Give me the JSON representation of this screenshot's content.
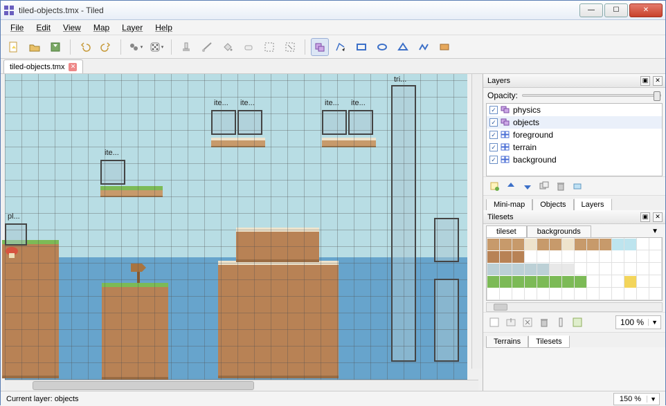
{
  "window": {
    "title": "tiled-objects.tmx - Tiled"
  },
  "menubar": [
    "File",
    "Edit",
    "View",
    "Map",
    "Layer",
    "Help"
  ],
  "doc_tab": {
    "label": "tiled-objects.tmx"
  },
  "layers_panel": {
    "title": "Layers",
    "opacity_label": "Opacity:",
    "layers": [
      {
        "name": "physics",
        "type": "object",
        "checked": true
      },
      {
        "name": "objects",
        "type": "object",
        "checked": true,
        "selected": true
      },
      {
        "name": "foreground",
        "type": "tile",
        "checked": true
      },
      {
        "name": "terrain",
        "type": "tile",
        "checked": true
      },
      {
        "name": "background",
        "type": "tile",
        "checked": true
      }
    ],
    "tabs": [
      "Mini-map",
      "Objects",
      "Layers"
    ],
    "active_tab": "Layers"
  },
  "tilesets_panel": {
    "title": "Tilesets",
    "tabs": [
      "tileset",
      "backgrounds"
    ],
    "active_tab": "tileset",
    "zoom": "100 %",
    "bottom_tabs": [
      "Terrains",
      "Tilesets"
    ],
    "active_bottom_tab": "Tilesets"
  },
  "canvas": {
    "object_labels": {
      "pl": "pl...",
      "ite1": "ite...",
      "ite2": "ite...",
      "ite3": "ite...",
      "ite4": "ite...",
      "ite5": "ite...",
      "tri": "tri..."
    }
  },
  "statusbar": {
    "text": "Current layer: objects",
    "zoom": "150 %"
  }
}
